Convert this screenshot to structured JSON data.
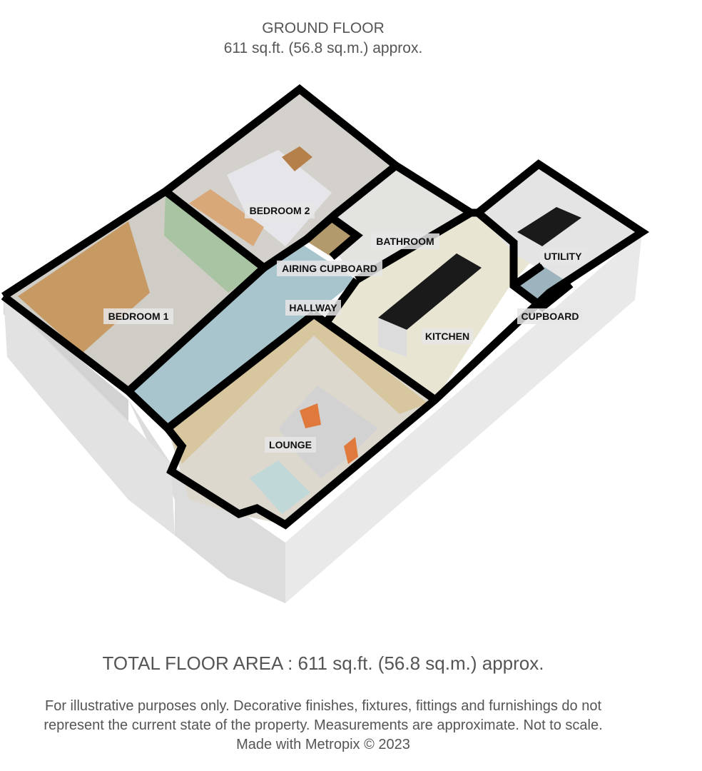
{
  "header": {
    "floor_name": "GROUND FLOOR",
    "floor_area": "611 sq.ft. (56.8 sq.m.) approx."
  },
  "rooms": {
    "bedroom2": "BEDROOM 2",
    "bedroom1": "BEDROOM 1",
    "bathroom": "BATHROOM",
    "airing_cupboard": "AIRING CUPBOARD",
    "hallway": "HALLWAY",
    "kitchen": "KITCHEN",
    "utility": "UTILITY",
    "cupboard": "CUPBOARD",
    "lounge": "LOUNGE"
  },
  "footer": {
    "total_area": "TOTAL FLOOR AREA : 611 sq.ft. (56.8 sq.m.) approx.",
    "disclaimer_line1": "For illustrative purposes only. Decorative finishes, fixtures, fittings and furnishings do not",
    "disclaimer_line2": "represent the current state of the property. Measurements are approximate. Not to scale.",
    "credit": "Made with Metropix © 2023"
  },
  "colors": {
    "wall": "#000000",
    "exterior": "#e6e6e6",
    "bedroom1_wall": "#a9c4a3",
    "hallway_wall": "#a8c4cc",
    "lounge_wall": "#d8c79e",
    "floor_carpet": "#d9d6cf",
    "wardrobe": "#c79a63",
    "kitchen_worktop": "#1a1a1a",
    "cushion": "#e07a3c"
  }
}
